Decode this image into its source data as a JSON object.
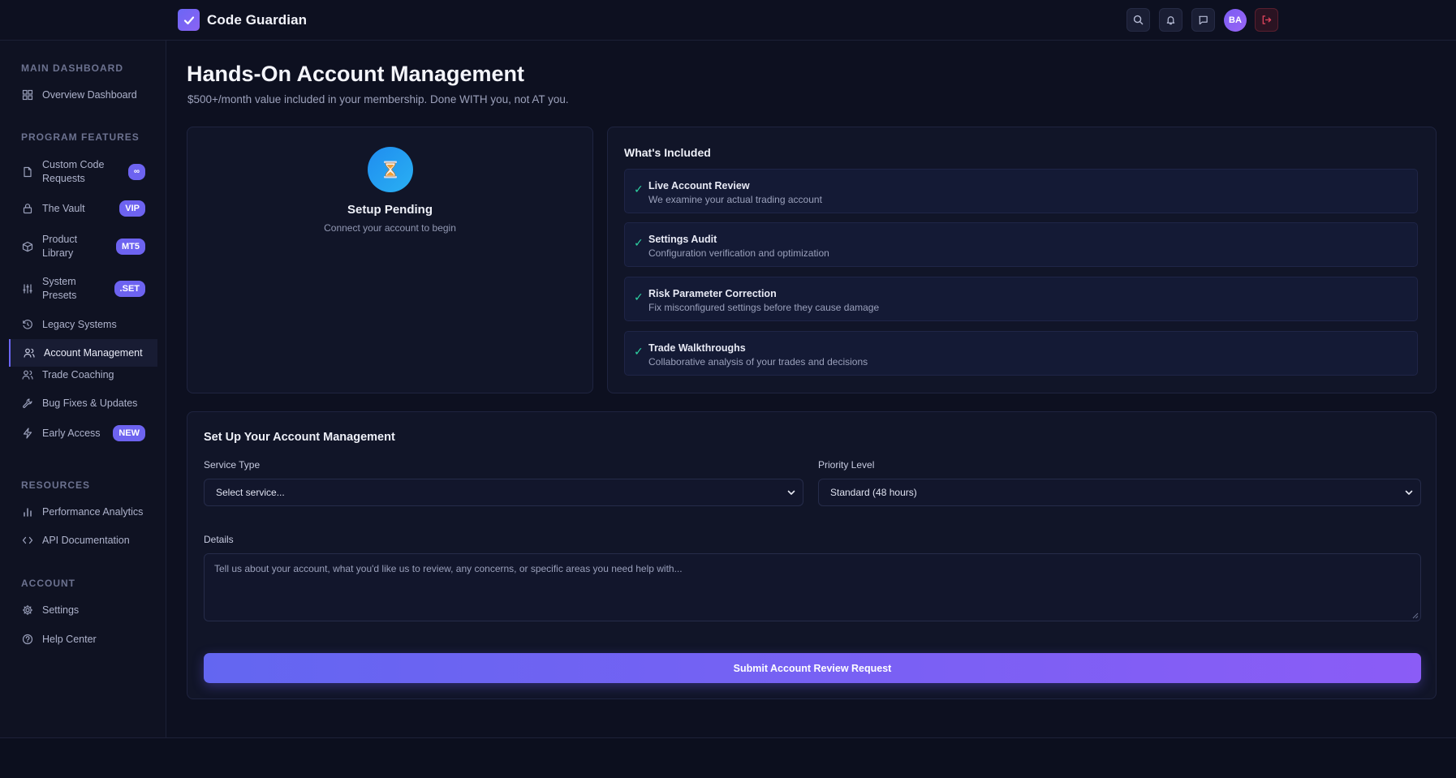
{
  "header": {
    "app_name": "Code Guardian",
    "avatar_initials": "BA",
    "icons": [
      "check-icon",
      "search-icon",
      "bell-icon",
      "message-icon",
      "logout-icon"
    ]
  },
  "sidebar": {
    "sections": [
      {
        "title": "MAIN DASHBOARD"
      },
      {
        "title": "PROGRAM FEATURES"
      },
      {
        "title": "RESOURCES"
      },
      {
        "title": "ACCOUNT"
      }
    ],
    "items": [
      {
        "label": "Overview Dashboard",
        "icon": "grid-icon"
      },
      {
        "label": "Custom Code Requests",
        "icon": "file-icon",
        "badge": "∞"
      },
      {
        "label": "The Vault",
        "icon": "lock-icon",
        "badge": "VIP"
      },
      {
        "label": "Product Library",
        "icon": "box-icon",
        "badge": "MT5"
      },
      {
        "label": "System Presets",
        "icon": "sliders-icon",
        "badge": ".SET"
      },
      {
        "label": "Legacy Systems",
        "icon": "history-icon"
      },
      {
        "label": "Account Management",
        "icon": "users-icon",
        "active": true
      },
      {
        "label": "Trade Coaching",
        "icon": "users-icon"
      },
      {
        "label": "Bug Fixes & Updates",
        "icon": "wrench-icon"
      },
      {
        "label": "Early Access",
        "icon": "bolt-icon",
        "badge": "NEW"
      },
      {
        "label": "Performance Analytics",
        "icon": "bar-chart-icon"
      },
      {
        "label": "API Documentation",
        "icon": "code-icon"
      },
      {
        "label": "Settings",
        "icon": "gear-icon"
      },
      {
        "label": "Help Center",
        "icon": "help-icon"
      }
    ]
  },
  "main": {
    "title": "Hands-On Account Management",
    "subtitle": "$500+/month value included in your membership. Done WITH you, not AT you.",
    "status": {
      "icon": "hourglass-icon",
      "title": "Setup Pending",
      "subtitle": "Connect your account to begin"
    },
    "included": {
      "title": "What's Included",
      "features": [
        {
          "title": "Live Account Review",
          "desc": "We examine your actual trading account"
        },
        {
          "title": "Settings Audit",
          "desc": "Configuration verification and optimization"
        },
        {
          "title": "Risk Parameter Correction",
          "desc": "Fix misconfigured settings before they cause damage"
        },
        {
          "title": "Trade Walkthroughs",
          "desc": "Collaborative analysis of your trades and decisions"
        }
      ]
    },
    "form": {
      "title": "Set Up Your Account Management",
      "service_type_label": "Service Type",
      "service_type_value": "Select service...",
      "priority_label": "Priority Level",
      "priority_value": "Standard (48 hours)",
      "details_label": "Details",
      "details_placeholder": "Tell us about your account, what you'd like us to review, any concerns, or specific areas you need help with...",
      "submit_label": "Submit Account Review Request"
    }
  },
  "colors": {
    "background": "#0d1020",
    "accent": "#6b66f5",
    "accent_end": "#8b5cf6",
    "success": "#2ed3a3",
    "danger": "#e0445c"
  }
}
